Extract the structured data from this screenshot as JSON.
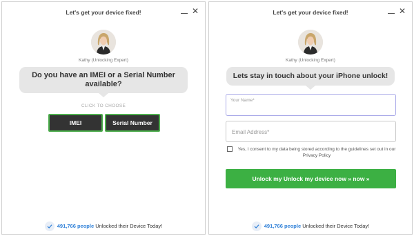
{
  "left": {
    "title": "Let's get your device fixed!",
    "expert": "Kathy (Unlocking Expert)",
    "question": "Do you have an IMEI or a Serial Number available?",
    "choose_label": "CLICK TO CHOOSE",
    "imei_label": "IMEI",
    "serial_label": "Serial Number",
    "footer_count": "491,766 people",
    "footer_text": "Unlocked their Device Today!"
  },
  "right": {
    "title": "Let's get your device fixed!",
    "expert": "Kathy (Unlocking Expert)",
    "question": "Lets stay in touch about your iPhone unlock!",
    "name_placeholder": "Your Name*",
    "email_placeholder": "Email Address*",
    "consent_text": "Yes, I consent to my data being stored according to the guidelines set out in our Privacy Policy",
    "cta_label": "Unlock my Unlock my device now » now »",
    "footer_count": "491,766 people",
    "footer_text": "Unlocked their Device Today!"
  },
  "icons": {
    "minimize": "minimize-icon",
    "close": "close-icon",
    "check": "check-circle-icon"
  },
  "colors": {
    "accent_green": "#3cb043",
    "button_dark": "#333333",
    "link_blue": "#2f80d8",
    "bubble_gray": "#e6e6e6"
  }
}
